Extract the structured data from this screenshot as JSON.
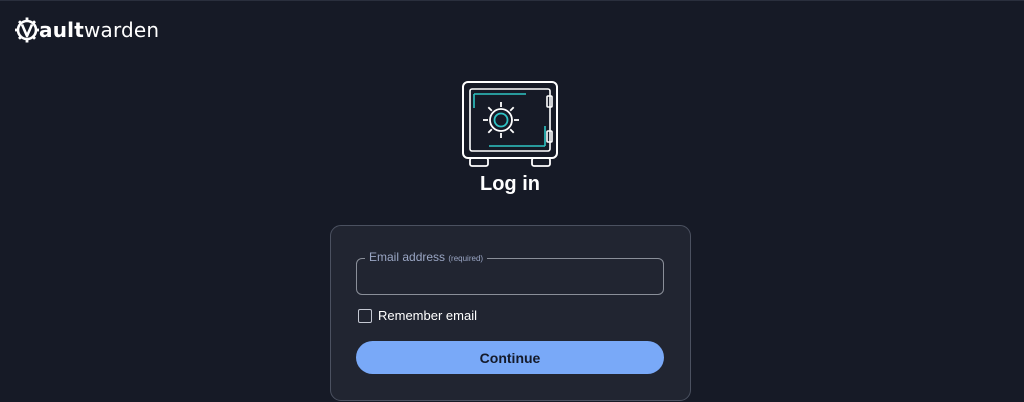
{
  "app": {
    "brand_bold": "ault",
    "brand_light": "warden",
    "brand_icon": "vaultwarden-gear-v-logo"
  },
  "page": {
    "title": "Log in",
    "illustration_icon": "safe-vault-icon"
  },
  "form": {
    "email": {
      "label": "Email address",
      "required_text": "(required)",
      "value": "",
      "placeholder": ""
    },
    "remember": {
      "label": "Remember email",
      "checked": false
    },
    "continue_label": "Continue"
  },
  "colors": {
    "background": "#161a26",
    "card": "#212531",
    "accent": "#79a9f8",
    "safe_teal": "#2ec4c4"
  }
}
